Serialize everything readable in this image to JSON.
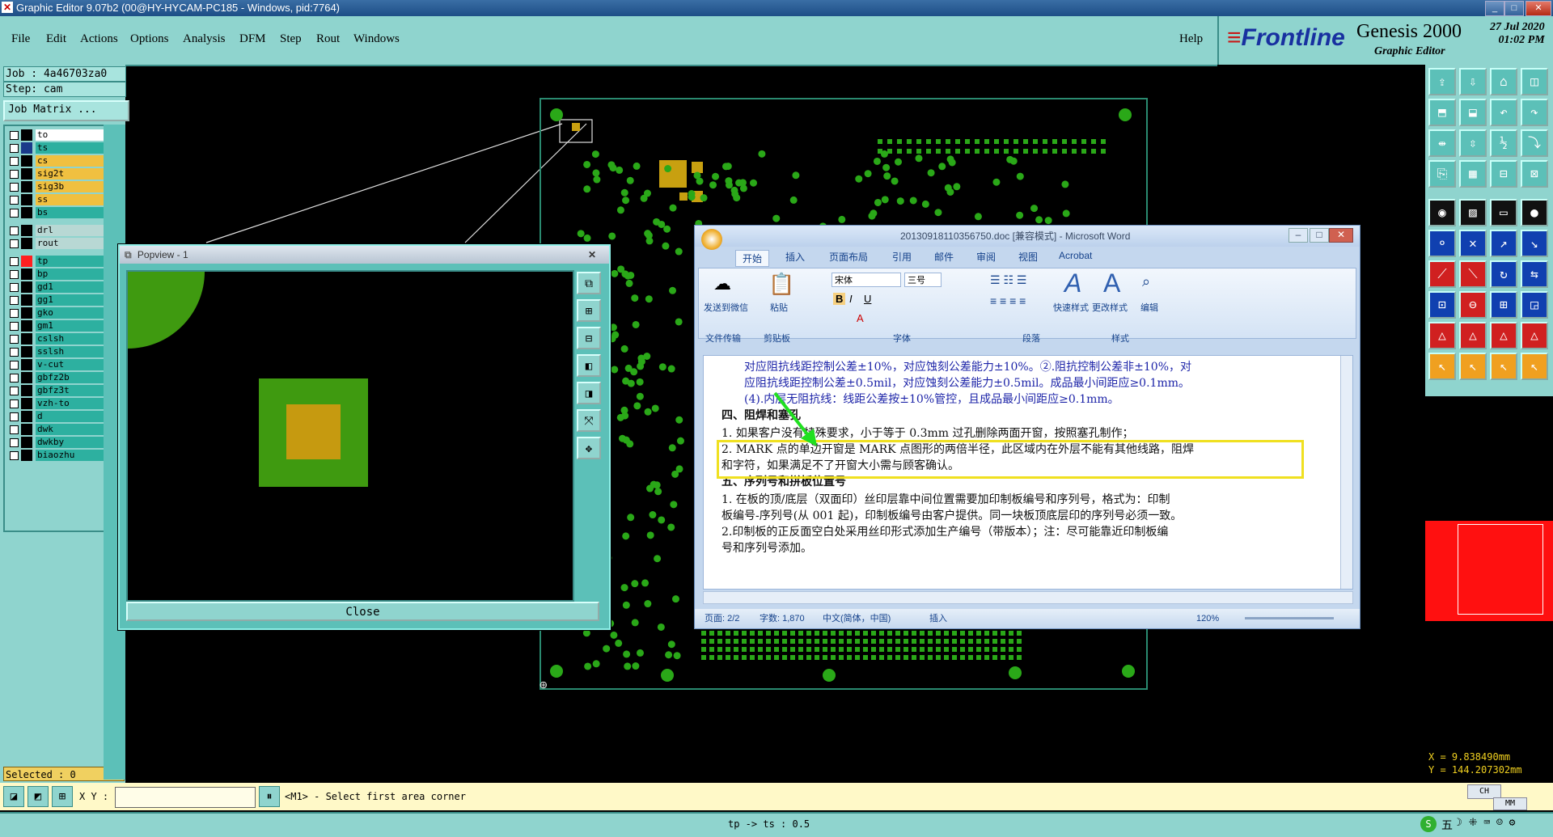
{
  "window": {
    "title": "Graphic Editor 9.07b2 (00@HY-HYCAM-PC185 - Windows, pid:7764)"
  },
  "menu": {
    "items": [
      "File",
      "Edit",
      "Actions",
      "Options",
      "Analysis",
      "DFM",
      "Step",
      "Rout",
      "Windows"
    ],
    "help": "Help"
  },
  "brand": {
    "frontline": "Frontline",
    "genesis": "Genesis 2000",
    "subtitle": "Graphic Editor",
    "date": "27 Jul 2020",
    "time": "01:02 PM"
  },
  "job": {
    "job_line": "Job : 4a46703za0",
    "step_line": "Step: cam",
    "matrix_label": "Job Matrix ..."
  },
  "layers": [
    {
      "name": "to",
      "color": "#ffffff"
    },
    {
      "name": "ts",
      "color": "#2db0a0",
      "active": true
    },
    {
      "name": "cs",
      "color": "#f0c040"
    },
    {
      "name": "sig2t",
      "color": "#f0c040"
    },
    {
      "name": "sig3b",
      "color": "#f0c040"
    },
    {
      "name": "ss",
      "color": "#f0c040"
    },
    {
      "name": "bs",
      "color": "#2db0a0"
    },
    {
      "name": "drl",
      "color": "#b8d8d4"
    },
    {
      "name": "rout",
      "color": "#b8d8d4"
    },
    {
      "name": "tp",
      "color": "#2db0a0",
      "swatch": "#ff2020"
    },
    {
      "name": "bp",
      "color": "#2db0a0"
    },
    {
      "name": "gd1",
      "color": "#2db0a0"
    },
    {
      "name": "gg1",
      "color": "#2db0a0"
    },
    {
      "name": "gko",
      "color": "#2db0a0"
    },
    {
      "name": "gm1",
      "color": "#2db0a0"
    },
    {
      "name": "cslsh",
      "color": "#2db0a0"
    },
    {
      "name": "sslsh",
      "color": "#2db0a0"
    },
    {
      "name": "v-cut",
      "color": "#2db0a0"
    },
    {
      "name": "gbfz2b",
      "color": "#2db0a0"
    },
    {
      "name": "gbfz3t",
      "color": "#2db0a0"
    },
    {
      "name": "vzh-to",
      "color": "#2db0a0"
    },
    {
      "name": "d",
      "color": "#2db0a0"
    },
    {
      "name": "dwk",
      "color": "#2db0a0"
    },
    {
      "name": "dwkby",
      "color": "#2db0a0"
    },
    {
      "name": "biaozhu",
      "color": "#2db0a0"
    }
  ],
  "selected": "Selected : 0",
  "popview": {
    "title": "Popview - 1",
    "close_label": "Close"
  },
  "word": {
    "title": "20130918110356750.doc [兼容模式] - Microsoft Word",
    "tabs": [
      "开始",
      "插入",
      "页面布局",
      "引用",
      "邮件",
      "审阅",
      "视图",
      "Acrobat"
    ],
    "ribbon": {
      "wechat": "发送到微信",
      "paste": "粘贴",
      "font_name": "宋体",
      "font_size": "三号",
      "quick_styles": "快速样式",
      "change_styles": "更改样式",
      "edit": "编辑",
      "groups": [
        "文件传输",
        "剪贴板",
        "字体",
        "段落",
        "样式"
      ]
    },
    "doc_lines": [
      "对应阻抗线距控制公差±10%，对应蚀刻公差能力±10%。②.阻抗控制公差非±10%，对",
      "应阻抗线距控制公差±0.5mil，对应蚀刻公差能力±0.5mil。成品最小间距应≥0.1mm。",
      "(4).内层无阻抗线：线距公差按±10%管控，且成品最小间距应≥0.1mm。",
      "四、阻焊和塞孔",
      "1. 如果客户没有特殊要求，小于等于 0.3mm 过孔删除两面开窗，按照塞孔制作；",
      "2. MARK 点的单边开窗是 MARK 点图形的两倍半径，此区域内在外层不能有其他线路，阻焊",
      "和字符，如果满足不了开窗大小需与顾客确认。",
      "五、序列号和拼板位置号",
      "1. 在板的顶/底层（双面印）丝印层靠中间位置需要加印制板编号和序列号，格式为：印制",
      "板编号-序列号(从 001 起)，印制板编号由客户提供。同一块板顶底层印的序列号必须一致。",
      "2.印制板的正反面空白处采用丝印形式添加生产编号（带版本）；注：尽可能靠近印制板编",
      "号和序列号添加。"
    ],
    "status": {
      "page": "页面: 2/2",
      "words": "字数: 1,870",
      "lang": "中文(简体，中国)",
      "mode": "插入",
      "zoom": "120%"
    }
  },
  "coords": {
    "x": "X = 9.838490mm",
    "y": "Y = 144.207302mm",
    "unit": "MM"
  },
  "command": {
    "xy_label": "X Y :",
    "xy_value": "",
    "prompt": "<M1> - Select first area corner"
  },
  "status_line": "tp -> ts : 0.5",
  "ime": {
    "lang": "CH",
    "ime_chars": "五"
  }
}
